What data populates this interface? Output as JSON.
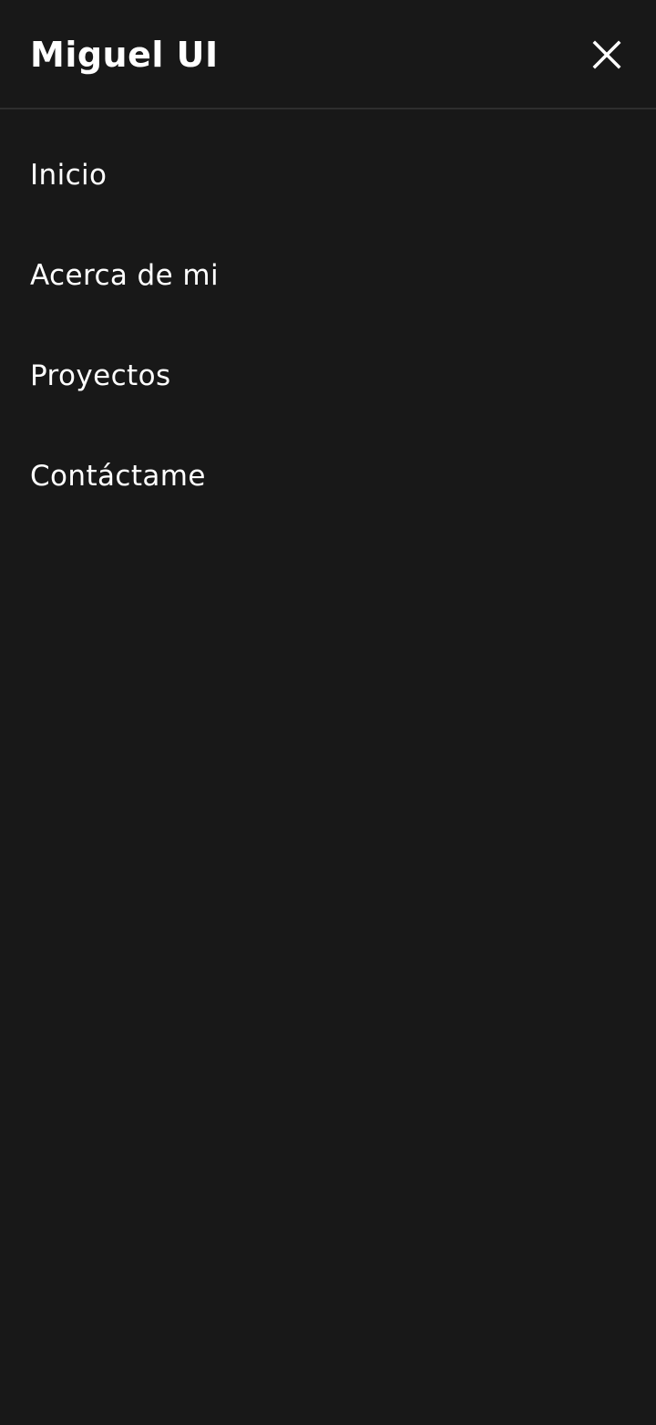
{
  "header": {
    "brand": "Miguel UI",
    "close_icon": "close-icon"
  },
  "menu": {
    "items": [
      {
        "label": "Inicio"
      },
      {
        "label": "Acerca de mi"
      },
      {
        "label": "Proyectos"
      },
      {
        "label": "Contáctame"
      }
    ]
  },
  "colors": {
    "background": "#181818",
    "text": "#ffffff",
    "divider": "#2e2e2e"
  }
}
